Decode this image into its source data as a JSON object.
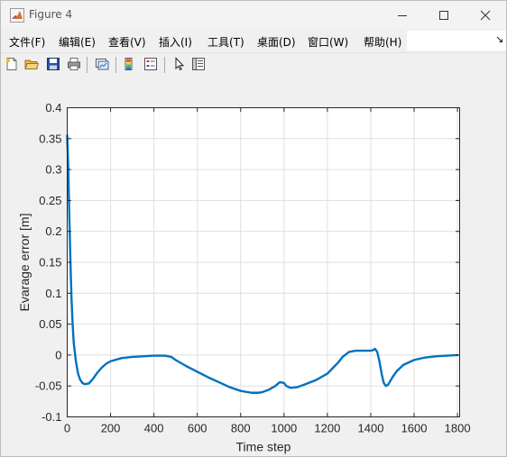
{
  "window": {
    "title": "Figure 4"
  },
  "menu": {
    "items": [
      {
        "label": "文件(F)"
      },
      {
        "label": "编辑(E)"
      },
      {
        "label": "查看(V)"
      },
      {
        "label": "插入(I)"
      },
      {
        "label": "工具(T)"
      },
      {
        "label": "桌面(D)"
      },
      {
        "label": "窗口(W)"
      },
      {
        "label": "帮助(H)"
      }
    ],
    "overflow_arrow": "↘"
  },
  "toolbar": {
    "icons": [
      "new-figure-icon",
      "open-file-icon",
      "save-icon",
      "print-icon",
      "link-plot-icon",
      "colorbar-icon",
      "legend-icon",
      "pointer-icon",
      "property-editor-icon"
    ]
  },
  "colors": {
    "line": "#0072bd",
    "grid": "#dfdfdf",
    "axes": "#262626"
  },
  "chart_data": {
    "type": "line",
    "title": "",
    "xlabel": "Time step",
    "ylabel": "Evarage error [m]",
    "xlim": [
      0,
      1810
    ],
    "ylim": [
      -0.1,
      0.4
    ],
    "xticks": [
      0,
      200,
      400,
      600,
      800,
      1000,
      1200,
      1400,
      1600,
      1800
    ],
    "yticks": [
      -0.1,
      -0.05,
      0,
      0.05,
      0.1,
      0.15,
      0.2,
      0.25,
      0.3,
      0.35,
      0.4
    ],
    "ytick_labels": [
      "-0.1",
      "-0.05",
      "0",
      "0.05",
      "0.1",
      "0.15",
      "0.2",
      "0.25",
      "0.3",
      "0.35",
      "0.4"
    ],
    "grid": true,
    "series": [
      {
        "x": [
          0,
          5,
          10,
          15,
          20,
          25,
          30,
          40,
          50,
          60,
          70,
          80,
          100,
          120,
          140,
          160,
          180,
          200,
          250,
          300,
          350,
          400,
          450,
          480,
          500,
          550,
          600,
          650,
          700,
          750,
          800,
          850,
          880,
          900,
          930,
          960,
          980,
          1000,
          1010,
          1030,
          1060,
          1100,
          1150,
          1200,
          1250,
          1270,
          1300,
          1330,
          1360,
          1400,
          1410,
          1420,
          1430,
          1440,
          1450,
          1460,
          1470,
          1480,
          1500,
          1520,
          1550,
          1600,
          1650,
          1700,
          1750,
          1800
        ],
        "y": [
          0.355,
          0.3,
          0.22,
          0.15,
          0.09,
          0.05,
          0.02,
          -0.01,
          -0.03,
          -0.04,
          -0.045,
          -0.047,
          -0.046,
          -0.038,
          -0.028,
          -0.02,
          -0.014,
          -0.01,
          -0.005,
          -0.003,
          -0.002,
          -0.001,
          -0.001,
          -0.003,
          -0.008,
          -0.018,
          -0.027,
          -0.036,
          -0.044,
          -0.052,
          -0.058,
          -0.061,
          -0.061,
          -0.06,
          -0.056,
          -0.05,
          -0.044,
          -0.045,
          -0.05,
          -0.053,
          -0.052,
          -0.047,
          -0.04,
          -0.03,
          -0.012,
          -0.003,
          0.005,
          0.007,
          0.007,
          0.007,
          0.008,
          0.01,
          0.005,
          -0.01,
          -0.03,
          -0.045,
          -0.05,
          -0.048,
          -0.036,
          -0.026,
          -0.016,
          -0.008,
          -0.004,
          -0.002,
          -0.001,
          0.0
        ]
      }
    ]
  }
}
